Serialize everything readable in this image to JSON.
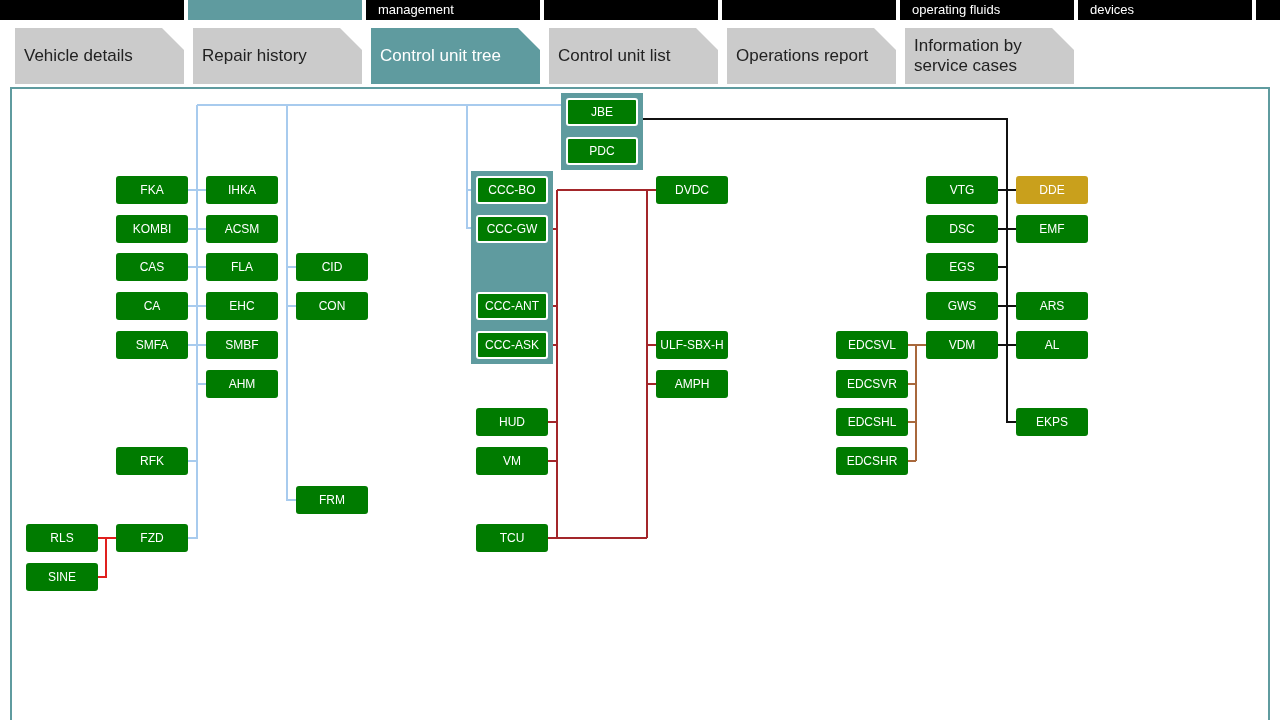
{
  "main_menu": [
    {
      "selected": false
    },
    {
      "selected": true
    },
    {
      "label": "management",
      "selected": false
    },
    {
      "selected": false
    },
    {
      "selected": false
    },
    {
      "label": "operating fluids",
      "selected": false
    },
    {
      "label": "devices",
      "selected": false
    }
  ],
  "tabs": [
    {
      "label": "Vehicle details",
      "selected": false
    },
    {
      "label": "Repair history",
      "selected": false
    },
    {
      "label": "Control unit tree",
      "selected": true
    },
    {
      "label": "Control unit list",
      "selected": false
    },
    {
      "label": "Operations report",
      "selected": false
    },
    {
      "label": "Information by service cases",
      "selected": false
    }
  ],
  "control_unit_tree": {
    "nodes": [
      {
        "label": "JBE",
        "color": "#007b00",
        "highlighted": true
      },
      {
        "label": "PDC",
        "color": "#007b00",
        "highlighted": true
      },
      {
        "label": "FKA",
        "color": "#007b00",
        "highlighted": false
      },
      {
        "label": "IHKA",
        "color": "#007b00",
        "highlighted": false
      },
      {
        "label": "CCC-BO",
        "color": "#007b00",
        "highlighted": true
      },
      {
        "label": "DVDC",
        "color": "#007b00",
        "highlighted": false
      },
      {
        "label": "VTG",
        "color": "#007b00",
        "highlighted": false
      },
      {
        "label": "DDE",
        "color": "#c9a01c",
        "highlighted": false
      },
      {
        "label": "KOMBI",
        "color": "#007b00",
        "highlighted": false
      },
      {
        "label": "ACSM",
        "color": "#007b00",
        "highlighted": false
      },
      {
        "label": "CCC-GW",
        "color": "#007b00",
        "highlighted": true
      },
      {
        "label": "DSC",
        "color": "#007b00",
        "highlighted": false
      },
      {
        "label": "EMF",
        "color": "#007b00",
        "highlighted": false
      },
      {
        "label": "CAS",
        "color": "#007b00",
        "highlighted": false
      },
      {
        "label": "FLA",
        "color": "#007b00",
        "highlighted": false
      },
      {
        "label": "CID",
        "color": "#007b00",
        "highlighted": false
      },
      {
        "label": "EGS",
        "color": "#007b00",
        "highlighted": false
      },
      {
        "label": "CA",
        "color": "#007b00",
        "highlighted": false
      },
      {
        "label": "EHC",
        "color": "#007b00",
        "highlighted": false
      },
      {
        "label": "CON",
        "color": "#007b00",
        "highlighted": false
      },
      {
        "label": "CCC-ANT",
        "color": "#007b00",
        "highlighted": true
      },
      {
        "label": "GWS",
        "color": "#007b00",
        "highlighted": false
      },
      {
        "label": "ARS",
        "color": "#007b00",
        "highlighted": false
      },
      {
        "label": "SMFA",
        "color": "#007b00",
        "highlighted": false
      },
      {
        "label": "SMBF",
        "color": "#007b00",
        "highlighted": false
      },
      {
        "label": "CCC-ASK",
        "color": "#007b00",
        "highlighted": true
      },
      {
        "label": "ULF-SBX-H",
        "color": "#007b00",
        "highlighted": false
      },
      {
        "label": "EDCSVL",
        "color": "#007b00",
        "highlighted": false
      },
      {
        "label": "VDM",
        "color": "#007b00",
        "highlighted": false
      },
      {
        "label": "AL",
        "color": "#007b00",
        "highlighted": false
      },
      {
        "label": "AHM",
        "color": "#007b00",
        "highlighted": false
      },
      {
        "label": "AMPH",
        "color": "#007b00",
        "highlighted": false
      },
      {
        "label": "EDCSVR",
        "color": "#007b00",
        "highlighted": false
      },
      {
        "label": "HUD",
        "color": "#007b00",
        "highlighted": false
      },
      {
        "label": "EDCSHL",
        "color": "#007b00",
        "highlighted": false
      },
      {
        "label": "EKPS",
        "color": "#007b00",
        "highlighted": false
      },
      {
        "label": "RFK",
        "color": "#007b00",
        "highlighted": false
      },
      {
        "label": "VM",
        "color": "#007b00",
        "highlighted": false
      },
      {
        "label": "EDCSHR",
        "color": "#007b00",
        "highlighted": false
      },
      {
        "label": "FRM",
        "color": "#007b00",
        "highlighted": false
      },
      {
        "label": "RLS",
        "color": "#007b00",
        "highlighted": false
      },
      {
        "label": "FZD",
        "color": "#007b00",
        "highlighted": false
      },
      {
        "label": "TCU",
        "color": "#007b00",
        "highlighted": false
      },
      {
        "label": "SINE",
        "color": "#007b00",
        "highlighted": false
      }
    ],
    "buses": [
      {
        "color": "#a8cbee"
      },
      {
        "color": "#111111"
      },
      {
        "color": "#a3262a"
      },
      {
        "color": "#a8683c"
      },
      {
        "color": "#e0201e"
      }
    ]
  }
}
